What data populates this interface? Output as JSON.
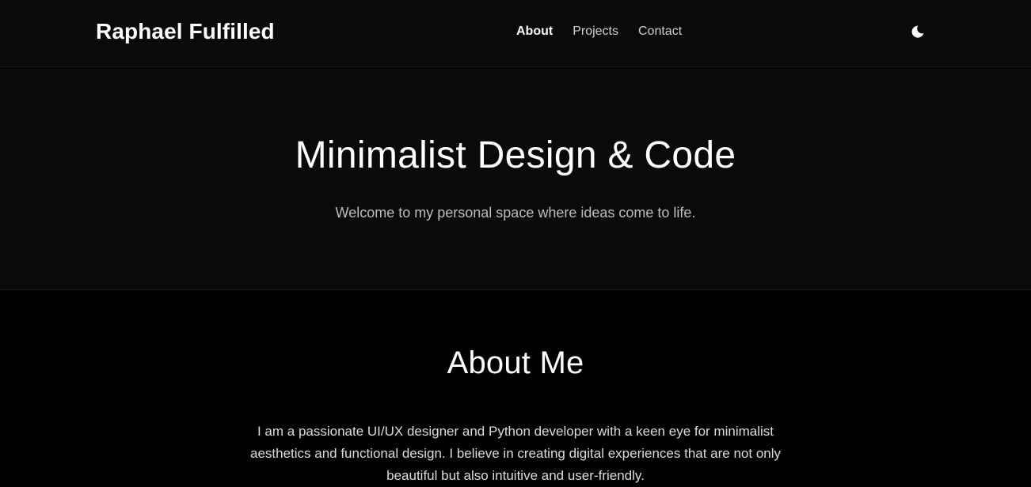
{
  "header": {
    "brand": "Raphael Fulfilled",
    "nav": [
      {
        "label": "About",
        "active": true
      },
      {
        "label": "Projects",
        "active": false
      },
      {
        "label": "Contact",
        "active": false
      }
    ],
    "theme_toggle_icon": "moon-icon"
  },
  "hero": {
    "title": "Minimalist Design & Code",
    "subtitle": "Welcome to my personal space where ideas come to life."
  },
  "about": {
    "heading": "About Me",
    "body": "I am a passionate UI/UX designer and Python developer with a keen eye for minimalist aesthetics and functional design. I believe in creating digital experiences that are not only beautiful but also intuitive and user-friendly."
  },
  "colors": {
    "background": "#000000",
    "header_background": "#0a0a0a",
    "text_primary": "#ffffff",
    "text_muted": "#bdbdbd"
  }
}
